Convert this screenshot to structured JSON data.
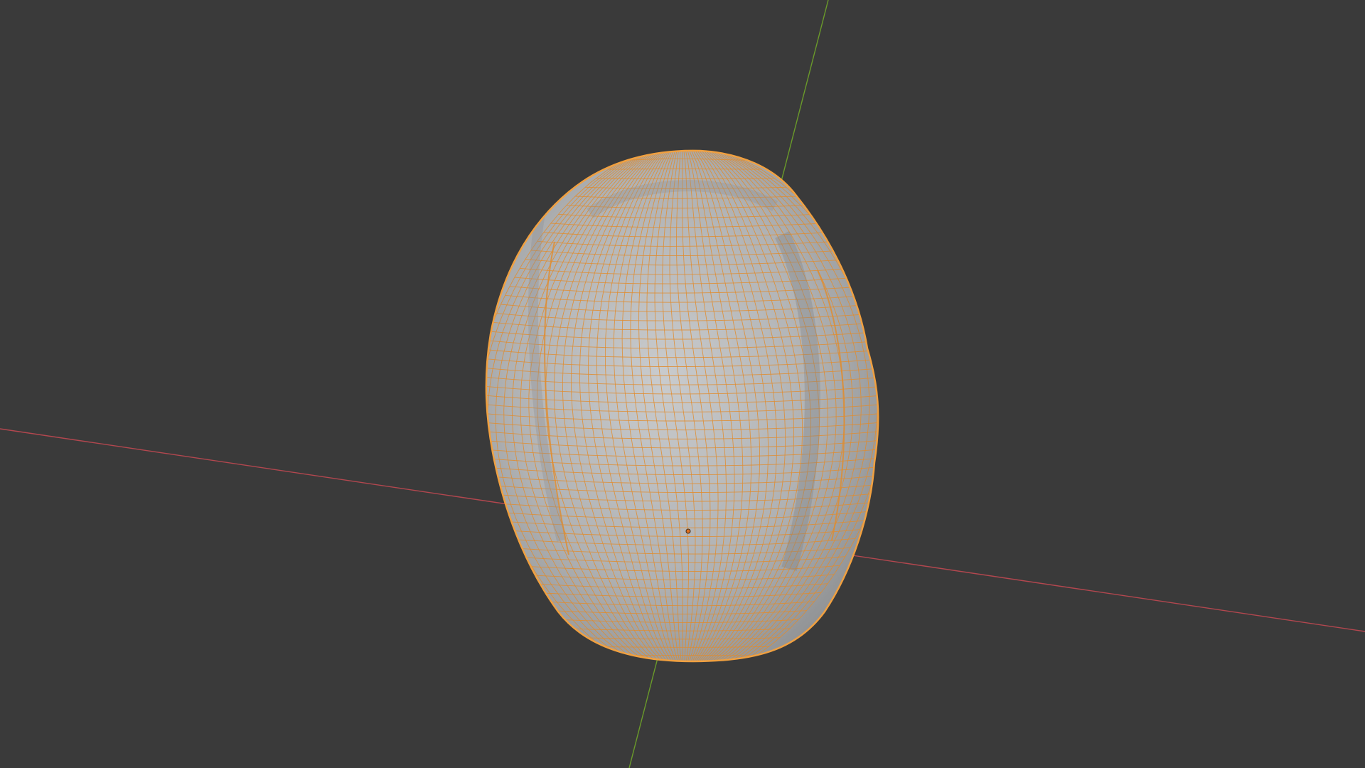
{
  "viewport": {
    "background_color": "#3a3a3a",
    "x_axis_color": "#b3474f",
    "y_axis_color": "#6a9a2a",
    "mesh_fill_color": "#b4b6b8",
    "wireframe_color": "#e08c2e",
    "selected_object_outline_color": "#f0a040",
    "origin_color": "#e07020"
  },
  "scene": {
    "object_icon": "sculpted-egg-mesh",
    "object_selected": true,
    "shading_mode": "solid-with-wireframe-overlay"
  }
}
